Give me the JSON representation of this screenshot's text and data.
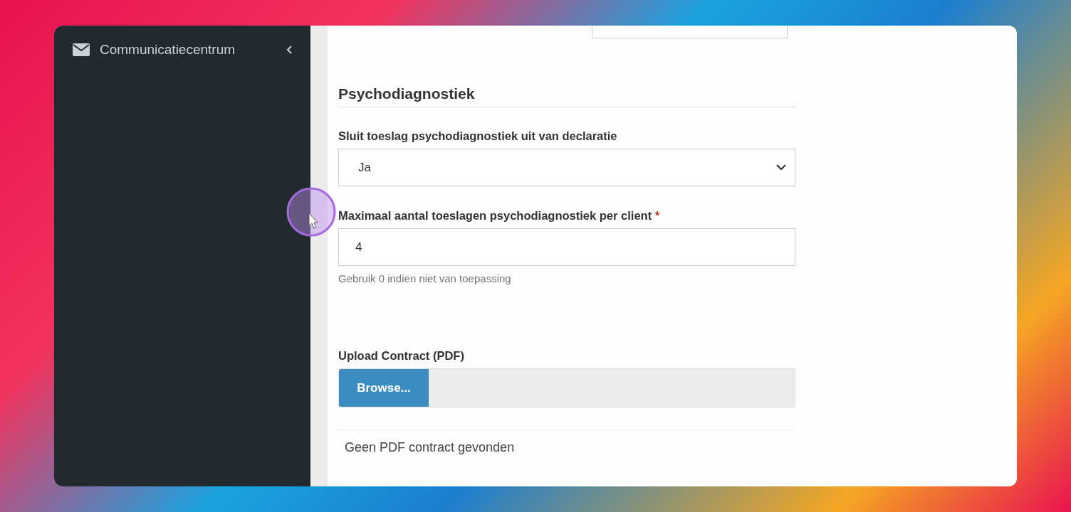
{
  "sidebar": {
    "items": [
      {
        "label": "Communicatiecentrum"
      }
    ]
  },
  "form": {
    "section_title": "Psychodiagnostiek",
    "fields": [
      {
        "kind": "select",
        "label": "Sluit toeslag psychodiagnostiek uit van declaratie",
        "value": "Ja"
      },
      {
        "kind": "number",
        "label": "Maximaal aantal toeslagen psychodiagnostiek per client",
        "required_mark": "*",
        "value": "4",
        "help": "Gebruik 0 indien niet van toepassing"
      }
    ],
    "upload": {
      "label": "Upload Contract (PDF)",
      "button": "Browse..."
    },
    "contract_status": "Geen PDF contract gevonden"
  }
}
